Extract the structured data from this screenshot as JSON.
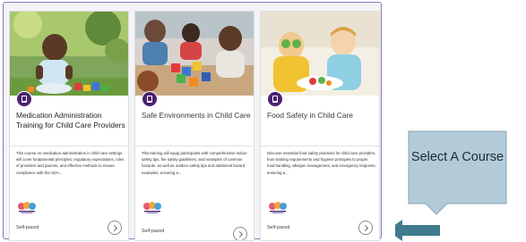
{
  "courses": [
    {
      "title": "Medication Administration Training for Child Care Providers",
      "description": "This course on medication administration in child care settings will cover fundamental principles, regulatory expectations, roles of providers and parents, and effective methods to ensure compliance with the ADA...",
      "pace": "Self-paced",
      "type_icon": "book-icon",
      "logo_icon": "provider-logo"
    },
    {
      "title": "Safe Environments in Child Care",
      "description": "This training will equip participants with comprehensive indoor safety tips, fire safety guidelines, and examples of common hazards, as well as outdoor safety tips and additional hazard examples, ensuring a...",
      "pace": "Self-paced",
      "type_icon": "book-icon",
      "logo_icon": "provider-logo"
    },
    {
      "title": "Food Safety in Child Care",
      "description": "Discover essential food safety practices for child care providers, from training requirements and hygiene principles to proper food handling, allergen management, and emergency response, ensuring a...",
      "pace": "Self-paced",
      "type_icon": "book-icon",
      "logo_icon": "provider-logo"
    }
  ],
  "annotation": {
    "text": "Select A Course",
    "box_color": "#b3cbd8",
    "arrow_color": "#3f7a8e"
  },
  "colors": {
    "frame": "#8a78b4",
    "badge": "#4b2170"
  }
}
